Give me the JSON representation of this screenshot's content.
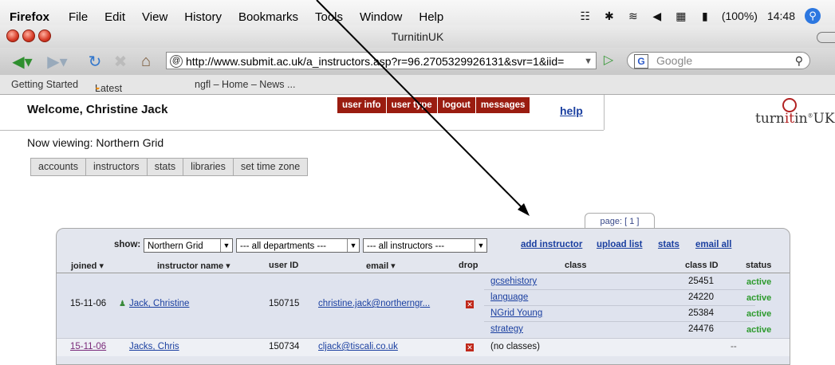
{
  "menubar": {
    "app_name": "Firefox",
    "menus": [
      "File",
      "Edit",
      "View",
      "History",
      "Bookmarks",
      "Tools",
      "Window",
      "Help"
    ],
    "battery": "(100%)",
    "clock": "14:48"
  },
  "window": {
    "title": "TurnitinUK"
  },
  "toolbar": {
    "url": "http://www.submit.ac.uk/a_instructors.asp?r=96.2705329926131&svr=1&iid=",
    "search_placeholder": "Google"
  },
  "bookmarks": {
    "items": [
      "Getting Started",
      "Latest Headlines",
      "ngfl – Home – News ..."
    ]
  },
  "page": {
    "welcome": "Welcome, Christine Jack",
    "top_tabs": [
      "user info",
      "user type",
      "logout",
      "messages"
    ],
    "help": "help",
    "logo": {
      "pre": "turn",
      "mid": "it",
      "post": "in",
      "tail": "UK"
    },
    "viewing": "Now viewing: Northern Grid",
    "sub_tabs": [
      "accounts",
      "instructors",
      "stats",
      "libraries",
      "set time zone"
    ],
    "pagination": "page: [ 1 ]"
  },
  "filters": {
    "show_label": "show:",
    "grid": "Northern Grid",
    "departments": "--- all departments ---",
    "instructors": "--- all instructors ---",
    "links": [
      "add instructor",
      "upload list",
      "stats",
      "email all"
    ]
  },
  "table": {
    "headers": {
      "joined": "joined ▾",
      "name": "instructor name ▾",
      "userid": "user ID",
      "email": "email ▾",
      "drop": "drop",
      "class": "class",
      "classid": "class ID",
      "status": "status"
    },
    "rows": [
      {
        "joined": "15-11-06",
        "name": "Jack, Christine",
        "userid": "150715",
        "email": "christine.jack@northerngr...",
        "classes": [
          {
            "name": "gcsehistory",
            "id": "25451",
            "status": "active"
          },
          {
            "name": "language",
            "id": "24220",
            "status": "active"
          },
          {
            "name": "NGrid Young",
            "id": "25384",
            "status": "active"
          },
          {
            "name": "strategy",
            "id": "24476",
            "status": "active"
          }
        ]
      },
      {
        "joined": "15-11-06",
        "name": "Jacks, Chris",
        "userid": "150734",
        "email": "cljack@tiscali.co.uk",
        "no_classes": "(no classes)",
        "status": "--"
      }
    ]
  }
}
